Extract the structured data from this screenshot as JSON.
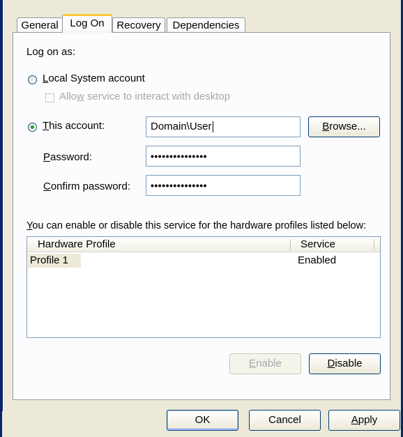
{
  "tabs": [
    {
      "label": "General"
    },
    {
      "label": "Log On"
    },
    {
      "label": "Recovery"
    },
    {
      "label": "Dependencies"
    }
  ],
  "logon": {
    "group_label": "Log on as:",
    "local_system": {
      "first": "L",
      "rest": "ocal System account",
      "checked": false
    },
    "allow_interact": {
      "pre": "Allo",
      "accel": "w",
      "post": " service to interact with desktop",
      "checked": false,
      "enabled": false
    },
    "this_account": {
      "first": "T",
      "rest": "his account:",
      "checked": true,
      "value": "Domain\\User"
    },
    "browse": {
      "first": "B",
      "rest": "rowse..."
    },
    "password": {
      "first": "P",
      "rest": "assword:",
      "value": "•••••••••••••••"
    },
    "confirm_password": {
      "first": "C",
      "rest": "onfirm password:",
      "value": "•••••••••••••••"
    }
  },
  "profiles": {
    "description": {
      "first": "Y",
      "rest": "ou can enable or disable this service for the hardware profiles listed below:"
    },
    "columns": [
      "Hardware Profile",
      "Service"
    ],
    "rows": [
      {
        "profile": "Profile 1",
        "service": "Enabled"
      }
    ],
    "enable": {
      "first": "E",
      "rest": "nable",
      "enabled": false
    },
    "disable": {
      "first": "D",
      "rest": "isable",
      "enabled": true
    }
  },
  "footer": {
    "ok": "OK",
    "cancel": "Cancel",
    "apply": {
      "first": "A",
      "rest": "pply"
    }
  }
}
